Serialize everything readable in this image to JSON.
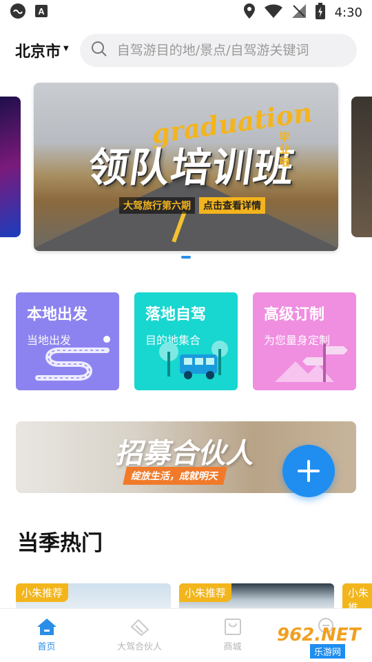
{
  "status_bar": {
    "time": "4:30"
  },
  "header": {
    "city": "北京市",
    "search_placeholder": "自驾游目的地/景点/自驾游关键词"
  },
  "banner": {
    "eng_text": "graduation",
    "title": "领队培训班",
    "side_text": "毕业啦",
    "sub_left": "大驾旅行第六期",
    "sub_right": "点击查看详情"
  },
  "categories": [
    {
      "title": "本地出发",
      "subtitle": "当地出发",
      "color": "#8c83f0"
    },
    {
      "title": "落地自驾",
      "subtitle": "目的地集合",
      "color": "#18d6d0"
    },
    {
      "title": "高级订制",
      "subtitle": "为您量身定制",
      "color": "#f08ee0"
    }
  ],
  "recruit": {
    "title": "招募合伙人",
    "slogan": "绽放生活，成就明天"
  },
  "section": {
    "title": "当季热门"
  },
  "hot_tags": [
    "小朱推荐",
    "小朱推荐",
    "小朱推"
  ],
  "tabs": [
    {
      "label": "首页",
      "icon": "home-icon",
      "active": true
    },
    {
      "label": "大驾合伙人",
      "icon": "handshake-icon",
      "active": false
    },
    {
      "label": "商城",
      "icon": "shopping-bag-icon",
      "active": false
    },
    {
      "label": "",
      "icon": "chat-icon",
      "active": false
    }
  ],
  "watermark": {
    "brand": "962.NET",
    "site": "乐游网"
  },
  "colors": {
    "accent": "#2a8ee6",
    "tag": "#f2b51c"
  }
}
